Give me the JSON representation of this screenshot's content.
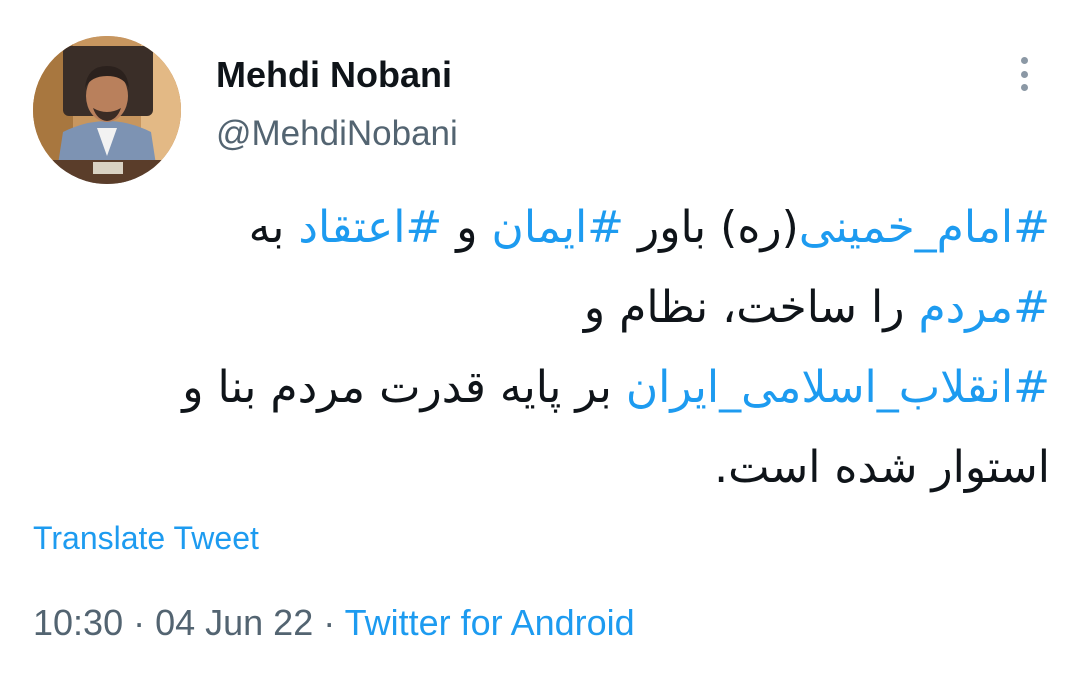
{
  "author": {
    "display_name": "Mehdi Nobani",
    "handle": "@MehdiNobani",
    "avatar_icon": "user-photo"
  },
  "tweet": {
    "lines": [
      [
        {
          "text": "#امام_خمینی",
          "hashtag": true
        },
        {
          "text": "(ره) باور ",
          "hashtag": false
        },
        {
          "text": "#ایمان",
          "hashtag": true
        },
        {
          "text": " و ",
          "hashtag": false
        },
        {
          "text": "#اعتقاد",
          "hashtag": true
        },
        {
          "text": " به",
          "hashtag": false
        }
      ],
      [
        {
          "text": "#مردم",
          "hashtag": true
        },
        {
          "text": " را ساخت، نظام و",
          "hashtag": false
        }
      ],
      [
        {
          "text": "#انقلاب_اسلامی_ایران",
          "hashtag": true
        },
        {
          "text": " بر پایه قدرت مردم بنا و",
          "hashtag": false
        }
      ],
      [
        {
          "text": "استوار شده است.",
          "hashtag": false
        }
      ]
    ]
  },
  "translate_label": "Translate Tweet",
  "meta": {
    "time": "10:30",
    "separator": " · ",
    "date": "04 Jun 22",
    "source": "Twitter for Android"
  },
  "colors": {
    "link": "#1d9bf0",
    "secondary_text": "#536471",
    "primary_text": "#0f1419",
    "more_icon": "#8b98a5"
  },
  "icons": {
    "more": "more-vertical-icon"
  }
}
